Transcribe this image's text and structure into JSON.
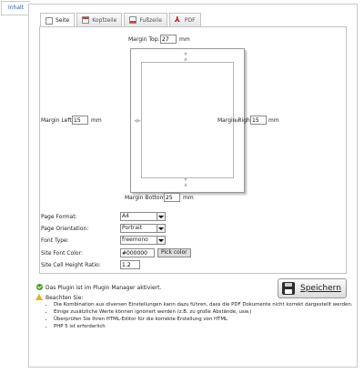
{
  "side_tab": {
    "label": "Inhalt"
  },
  "tabs": [
    {
      "label": "Seite",
      "icon": "page-icon",
      "active": true
    },
    {
      "label": "Kopfzeile",
      "icon": "header-icon"
    },
    {
      "label": "Fußzeile",
      "icon": "footer-icon"
    },
    {
      "label": "PDF",
      "icon": "pdf-icon"
    }
  ],
  "margins": {
    "top_label": "Margin Top:",
    "top_value": "27",
    "left_label": "Margin Left:",
    "left_value": "15",
    "right_label": "Margin Right:",
    "right_value": "15",
    "bottom_label": "Margin Bottom:",
    "bottom_value": "25",
    "unit": "mm"
  },
  "settings": {
    "page_format_label": "Page Format:",
    "page_format_value": "A4",
    "orientation_label": "Page Orientation:",
    "orientation_value": "Portrait",
    "font_type_label": "Font Type:",
    "font_type_value": "freemono",
    "font_color_label": "Site Font Color:",
    "font_color_value": "#000000",
    "pick_color_label": "Pick color",
    "cell_height_label": "Site Cell Height Ratio:",
    "cell_height_value": "1.2"
  },
  "messages": {
    "active_text": "Das Plugin ist im Plugin Manager aktiviert.",
    "note_heading": "Beachten Sie:",
    "notes": [
      "Die Kombination aus diversen Einstellungen kann dazu führen, dass die PDF Dokumente nicht korrekt dargestellt werden.",
      "Einige zusätzliche Werte können ignoriert werden (z.B. zu große Abstände, usw.)",
      "Überprüfen Sie Ihren HTML-Editor für die korrekte Erstellung von HTML",
      "PHP 5 ist erforderlich"
    ]
  },
  "save_button": {
    "label": "Speichern"
  },
  "colors": {
    "link": "#1a5fb4",
    "success": "#4a9a22",
    "warning": "#e6b800"
  }
}
